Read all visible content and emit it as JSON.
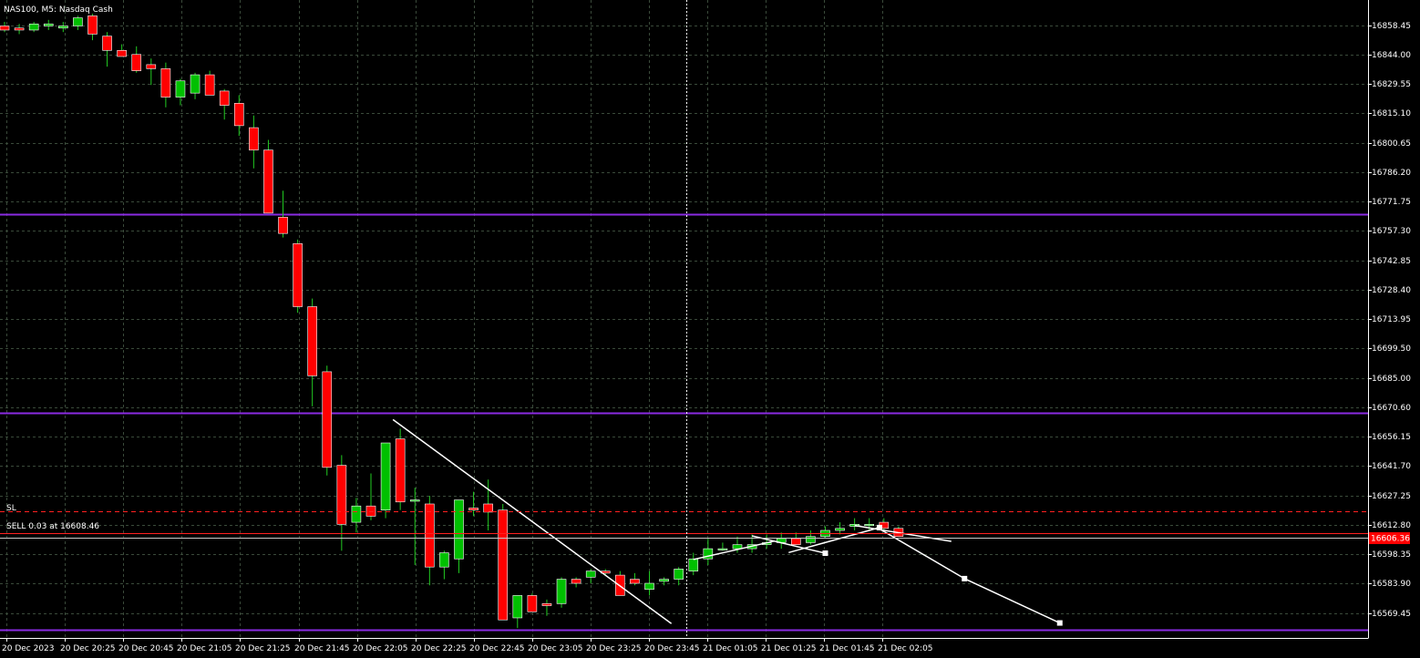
{
  "window": {
    "title": "NAS100, M5:  Nasdaq Cash"
  },
  "colors": {
    "background": "#000000",
    "grid": "#3a4a3a",
    "bull": "#00c000",
    "bear": "#ff0000",
    "wick": "#22cc22",
    "level": "#8a2be2",
    "sl_line": "#ff2020",
    "entry_line": "#ff2020",
    "bid_line": "#c8c8c8",
    "drawing": "#ffffff",
    "axis": "#ffffff"
  },
  "chart_data": {
    "type": "candlestick",
    "symbol": "NAS100",
    "timeframe": "M5",
    "ylim": [
      16557,
      16875
    ],
    "y_ticks": [
      "16858.45",
      "16844.00",
      "16829.55",
      "16815.10",
      "16800.65",
      "16786.20",
      "16771.75",
      "16757.30",
      "16742.85",
      "16728.40",
      "16713.95",
      "16699.50",
      "16685.00",
      "16670.60",
      "16656.15",
      "16641.70",
      "16627.25",
      "16612.80",
      "16598.35",
      "16583.90",
      "16569.45"
    ],
    "x_ticks": [
      "20 Dec 2023",
      "20 Dec 20:25",
      "20 Dec 20:45",
      "20 Dec 21:05",
      "20 Dec 21:25",
      "20 Dec 21:45",
      "20 Dec 22:05",
      "20 Dec 22:25",
      "20 Dec 22:45",
      "20 Dec 23:05",
      "20 Dec 23:25",
      "20 Dec 23:45",
      "21 Dec 01:05",
      "21 Dec 01:25",
      "21 Dec 01:45",
      "21 Dec 02:05"
    ],
    "candles": [
      [
        16858,
        16860,
        16855,
        16856
      ],
      [
        16857,
        16859,
        16854,
        16856
      ],
      [
        16856,
        16860,
        16855,
        16859
      ],
      [
        16858,
        16861,
        16856,
        16859
      ],
      [
        16857,
        16860,
        16855,
        16858
      ],
      [
        16858,
        16863,
        16856,
        16862
      ],
      [
        16863,
        16864,
        16851,
        16854
      ],
      [
        16853,
        16855,
        16838,
        16846
      ],
      [
        16846,
        16849,
        16843,
        16843
      ],
      [
        16844,
        16848,
        16835,
        16836
      ],
      [
        16839,
        16842,
        16829,
        16837
      ],
      [
        16837,
        16840,
        16818,
        16823
      ],
      [
        16823,
        16832,
        16819,
        16831
      ],
      [
        16825,
        16835,
        16822,
        16834
      ],
      [
        16834,
        16836,
        16824,
        16824
      ],
      [
        16826,
        16827,
        16812,
        16819
      ],
      [
        16820,
        16824,
        16804,
        16809
      ],
      [
        16808,
        16814,
        16788,
        16797
      ],
      [
        16797,
        16802,
        16766,
        16766
      ],
      [
        16764,
        16777,
        16754,
        16756
      ],
      [
        16751,
        16753,
        16717,
        16720
      ],
      [
        16720,
        16724,
        16671,
        16686
      ],
      [
        16688,
        16691,
        16637,
        16641
      ],
      [
        16642,
        16647,
        16600,
        16613
      ],
      [
        16614,
        16626,
        16609,
        16622
      ],
      [
        16622,
        16638,
        16615,
        16617
      ],
      [
        16620,
        16650,
        16616,
        16653
      ],
      [
        16655,
        16660,
        16620,
        16624
      ],
      [
        16625,
        16631,
        16593,
        16625
      ],
      [
        16623,
        16627,
        16583,
        16592
      ],
      [
        16592,
        16600,
        16586,
        16599
      ],
      [
        16596,
        16623,
        16589,
        16625
      ],
      [
        16621,
        16629,
        16617,
        16620
      ],
      [
        16623,
        16635,
        16610,
        16619
      ],
      [
        16620,
        16623,
        16570,
        16566
      ],
      [
        16567,
        16576,
        16562,
        16578
      ],
      [
        16578,
        16579,
        16570,
        16570
      ],
      [
        16574,
        16576,
        16568,
        16573
      ],
      [
        16574,
        16587,
        16572,
        16586
      ],
      [
        16586,
        16587,
        16582,
        16584
      ],
      [
        16587,
        16591,
        16584,
        16590
      ],
      [
        16590,
        16591,
        16588,
        16589
      ],
      [
        16588,
        16590,
        16578,
        16578
      ],
      [
        16586,
        16589,
        16583,
        16584
      ],
      [
        16581,
        16590,
        16578,
        16584
      ],
      [
        16585,
        16587,
        16583,
        16586
      ],
      [
        16586,
        16592,
        16583,
        16591
      ],
      [
        16590,
        16599,
        16588,
        16596
      ],
      [
        16596,
        16606,
        16593,
        16601
      ],
      [
        16601,
        16604,
        16600,
        16601
      ],
      [
        16601,
        16607,
        16599,
        16603
      ],
      [
        16601,
        16608,
        16599,
        16603
      ],
      [
        16603,
        16608,
        16601,
        16604
      ],
      [
        16604,
        16609,
        16601,
        16606
      ],
      [
        16606,
        16609,
        16603,
        16603
      ],
      [
        16604,
        16610,
        16603,
        16607
      ],
      [
        16607,
        16612,
        16606,
        16610
      ],
      [
        16610,
        16614,
        16608,
        16611
      ],
      [
        16612,
        16616,
        16610,
        16613
      ],
      [
        16613,
        16616,
        16610,
        16613
      ],
      [
        16614,
        16616,
        16610,
        16611
      ],
      [
        16611,
        16612,
        16607,
        16607
      ]
    ],
    "levels": [
      16765.3,
      16667.9,
      16561.1
    ],
    "sl": {
      "label": "SL",
      "price": 16619.2
    },
    "entry": {
      "label": "SELL 0.03 at 16608.46",
      "price": 16608.46
    },
    "bid": {
      "price": 16606.4,
      "label": "16606.36"
    },
    "trendlines": [
      {
        "from": [
          26.5,
          16664.5
        ],
        "to": [
          45.5,
          16564.2
        ],
        "markers": false
      },
      {
        "from": [
          47.0,
          16595.7
        ],
        "to": [
          52.5,
          16604.7
        ],
        "markers": false
      },
      {
        "from": [
          51.0,
          16607.3
        ],
        "to": [
          56.0,
          16598.8
        ],
        "markers": true
      },
      {
        "from": [
          53.5,
          16599.1
        ],
        "to": [
          59.7,
          16611.4
        ],
        "markers": true
      },
      {
        "from": [
          58.0,
          16612.4
        ],
        "to": [
          64.6,
          16604.6
        ],
        "markers": false
      },
      {
        "from": [
          59.5,
          16611.6
        ],
        "to": [
          65.5,
          16586.3
        ],
        "markers": true
      },
      {
        "from": [
          65.5,
          16586.3
        ],
        "to": [
          72.0,
          16564.5
        ],
        "markers": true
      }
    ]
  }
}
